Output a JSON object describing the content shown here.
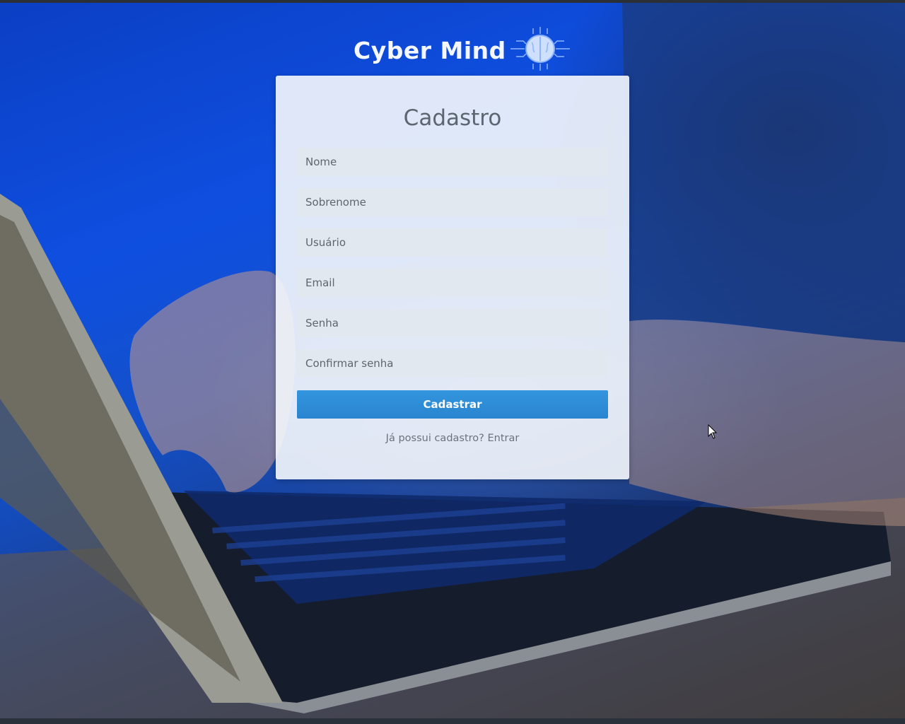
{
  "brand": {
    "name": "Cyber Mind",
    "logo_icon": "brain-circuit-icon"
  },
  "form": {
    "title": "Cadastro",
    "fields": [
      {
        "placeholder": "Nome",
        "value": ""
      },
      {
        "placeholder": "Sobrenome",
        "value": ""
      },
      {
        "placeholder": "Usuário",
        "value": ""
      },
      {
        "placeholder": "Email",
        "value": ""
      },
      {
        "placeholder": "Senha",
        "value": ""
      },
      {
        "placeholder": "Confirmar senha",
        "value": ""
      }
    ],
    "submit_label": "Cadastrar",
    "login_prompt": "Já possui cadastro?",
    "login_link": "Entrar"
  },
  "colors": {
    "accent": "#2f8fd9",
    "background_blue": "#0f4fe0"
  },
  "cursor_icon": "mouse-pointer-icon"
}
